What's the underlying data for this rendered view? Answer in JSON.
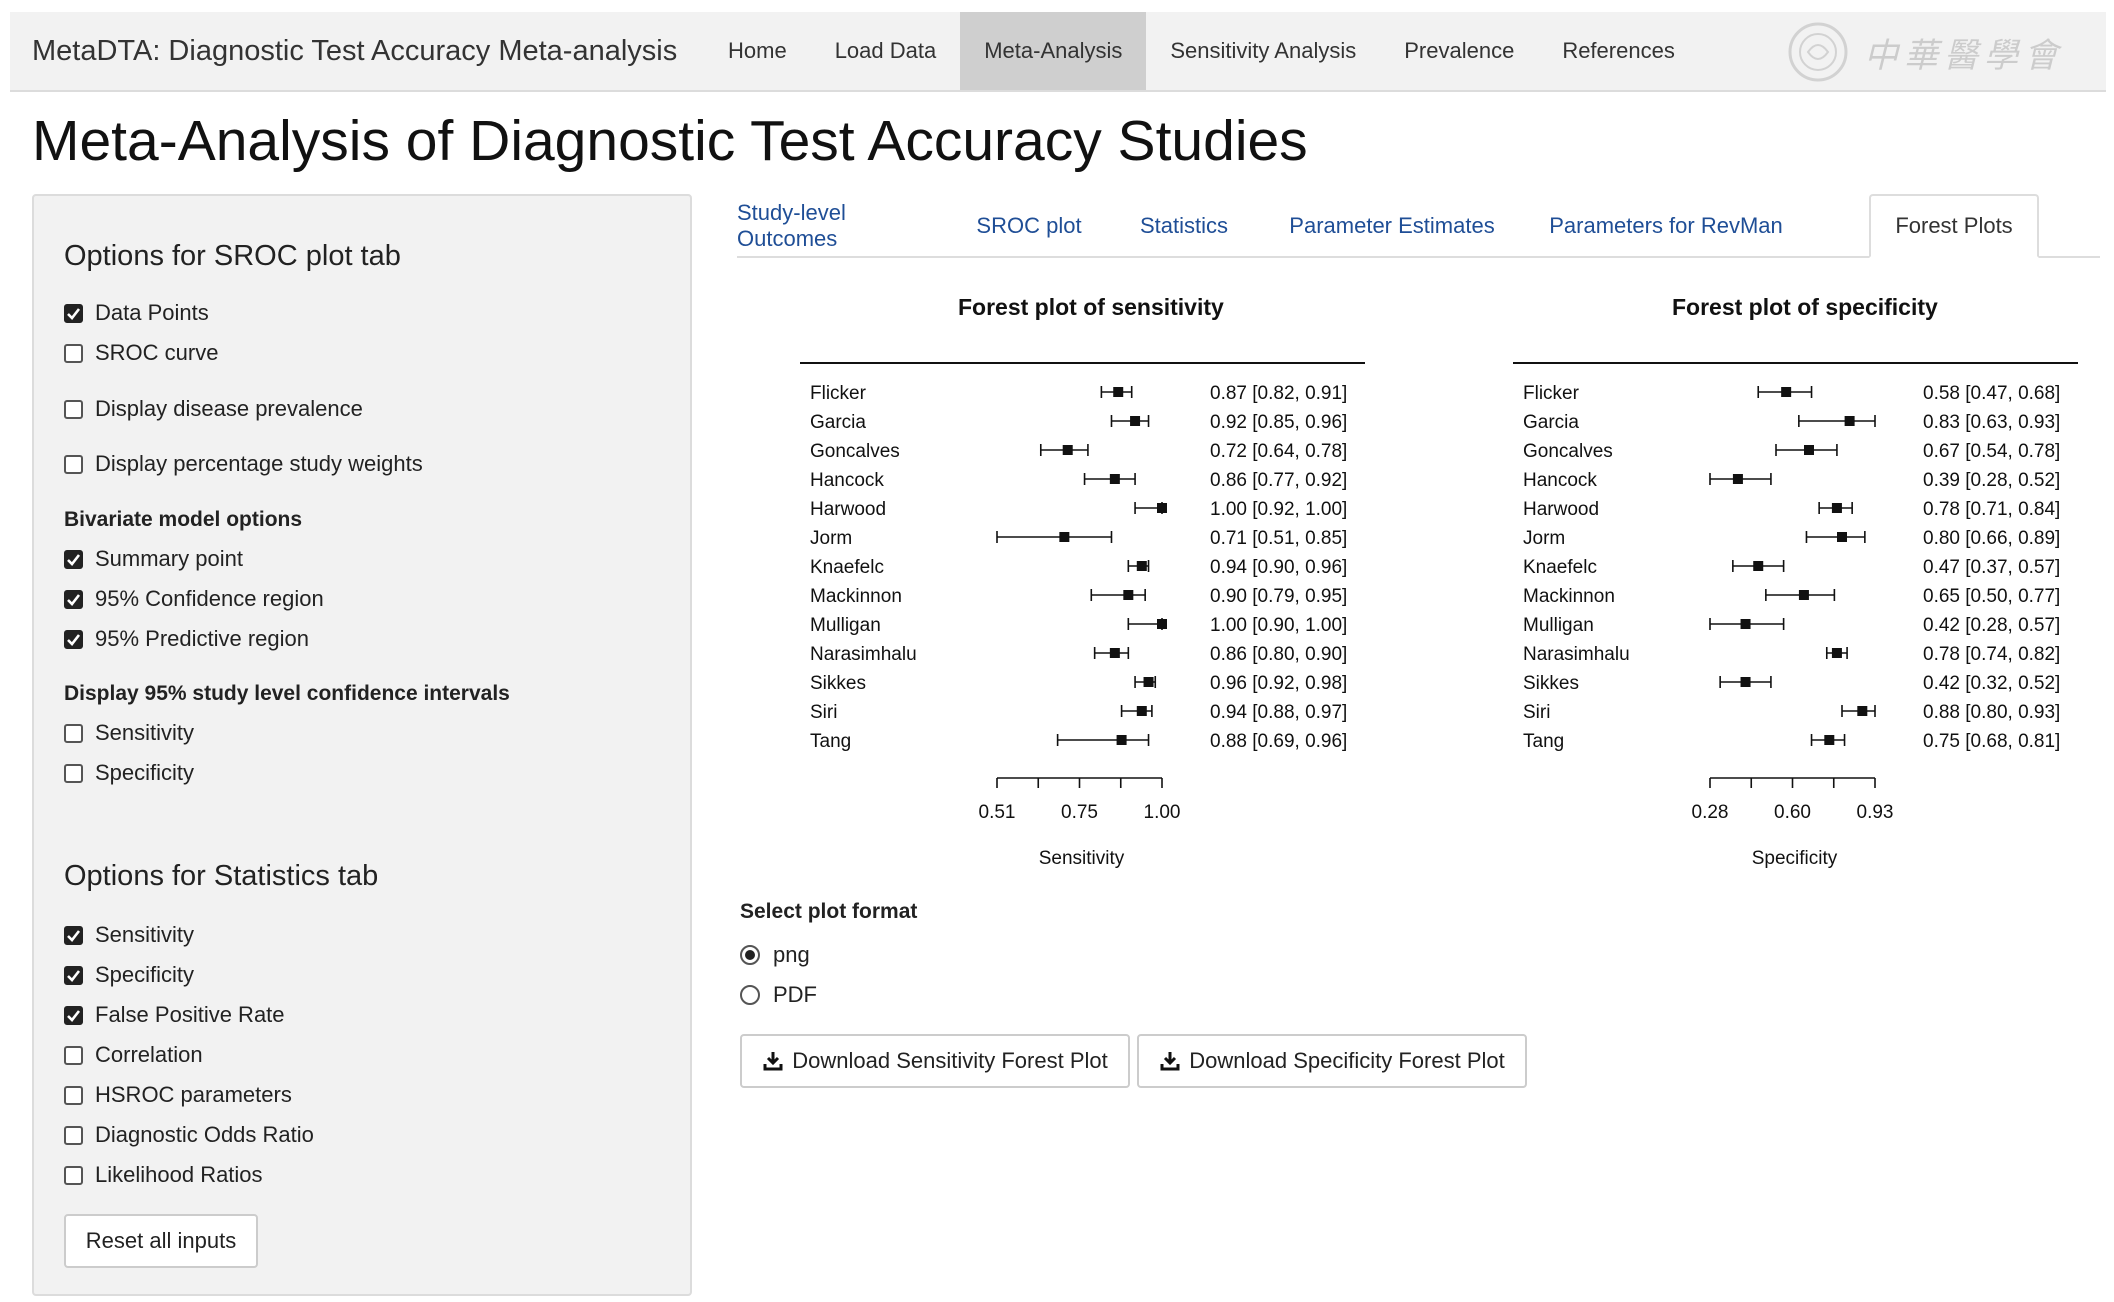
{
  "navbar": {
    "brand": "MetaDTA: Diagnostic Test Accuracy Meta-analysis",
    "items": [
      "Home",
      "Load Data",
      "Meta-Analysis",
      "Sensitivity Analysis",
      "Prevalence",
      "References"
    ],
    "active": "Meta-Analysis"
  },
  "page_title": "Meta-Analysis of Diagnostic Test Accuracy Studies",
  "sidebar": {
    "sroc_heading": "Options for SROC plot tab",
    "sroc_options": [
      {
        "label": "Data Points",
        "checked": true
      },
      {
        "label": "SROC curve",
        "checked": false
      },
      {
        "label": "Display disease prevalence",
        "checked": false
      },
      {
        "label": "Display percentage study weights",
        "checked": false
      }
    ],
    "bivariate_heading": "Bivariate model options",
    "bivariate_options": [
      {
        "label": "Summary point",
        "checked": true
      },
      {
        "label": "95% Confidence region",
        "checked": true
      },
      {
        "label": "95% Predictive region",
        "checked": true
      }
    ],
    "ci_heading": "Display 95% study level confidence intervals",
    "ci_options": [
      {
        "label": "Sensitivity",
        "checked": false
      },
      {
        "label": "Specificity",
        "checked": false
      }
    ],
    "stats_heading": "Options for Statistics tab",
    "stats_options": [
      {
        "label": "Sensitivity",
        "checked": true
      },
      {
        "label": "Specificity",
        "checked": true
      },
      {
        "label": "False Positive Rate",
        "checked": true
      },
      {
        "label": "Correlation",
        "checked": false
      },
      {
        "label": "HSROC parameters",
        "checked": false
      },
      {
        "label": "Diagnostic Odds Ratio",
        "checked": false
      },
      {
        "label": "Likelihood Ratios",
        "checked": false
      }
    ],
    "reset_label": "Reset all inputs"
  },
  "tabs": {
    "items": [
      "Study-level Outcomes",
      "SROC plot",
      "Statistics",
      "Parameter Estimates",
      "Parameters for RevMan",
      "Forest Plots"
    ],
    "active": "Forest Plots"
  },
  "chart_data": [
    {
      "type": "forest",
      "title": "Forest plot of sensitivity",
      "xlabel": "Sensitivity",
      "xticks": [
        "0.51",
        "0.75",
        "1.00"
      ],
      "xlim": [
        0.51,
        1.0
      ],
      "studies": [
        "Flicker",
        "Garcia",
        "Goncalves",
        "Hancock",
        "Harwood",
        "Jorm",
        "Knaefelc",
        "Mackinnon",
        "Mulligan",
        "Narasimhalu",
        "Sikkes",
        "Siri",
        "Tang"
      ],
      "estimates": [
        0.87,
        0.92,
        0.72,
        0.86,
        1.0,
        0.71,
        0.94,
        0.9,
        1.0,
        0.86,
        0.96,
        0.94,
        0.88
      ],
      "lower": [
        0.82,
        0.85,
        0.64,
        0.77,
        0.92,
        0.51,
        0.9,
        0.79,
        0.9,
        0.8,
        0.92,
        0.88,
        0.69
      ],
      "upper": [
        0.91,
        0.96,
        0.78,
        0.92,
        1.0,
        0.85,
        0.96,
        0.95,
        1.0,
        0.9,
        0.98,
        0.97,
        0.96
      ],
      "labels": [
        "0.87 [0.82, 0.91]",
        "0.92 [0.85, 0.96]",
        "0.72 [0.64, 0.78]",
        "0.86 [0.77, 0.92]",
        "1.00 [0.92, 1.00]",
        "0.71 [0.51, 0.85]",
        "0.94 [0.90, 0.96]",
        "0.90 [0.79, 0.95]",
        "1.00 [0.90, 1.00]",
        "0.86 [0.80, 0.90]",
        "0.96 [0.92, 0.98]",
        "0.94 [0.88, 0.97]",
        "0.88 [0.69, 0.96]"
      ]
    },
    {
      "type": "forest",
      "title": "Forest plot of specificity",
      "xlabel": "Specificity",
      "xticks": [
        "0.28",
        "0.60",
        "0.93"
      ],
      "xlim": [
        0.28,
        0.93
      ],
      "studies": [
        "Flicker",
        "Garcia",
        "Goncalves",
        "Hancock",
        "Harwood",
        "Jorm",
        "Knaefelc",
        "Mackinnon",
        "Mulligan",
        "Narasimhalu",
        "Sikkes",
        "Siri",
        "Tang"
      ],
      "estimates": [
        0.58,
        0.83,
        0.67,
        0.39,
        0.78,
        0.8,
        0.47,
        0.65,
        0.42,
        0.78,
        0.42,
        0.88,
        0.75
      ],
      "lower": [
        0.47,
        0.63,
        0.54,
        0.28,
        0.71,
        0.66,
        0.37,
        0.5,
        0.28,
        0.74,
        0.32,
        0.8,
        0.68
      ],
      "upper": [
        0.68,
        0.93,
        0.78,
        0.52,
        0.84,
        0.89,
        0.57,
        0.77,
        0.57,
        0.82,
        0.52,
        0.93,
        0.81
      ],
      "labels": [
        "0.58 [0.47, 0.68]",
        "0.83 [0.63, 0.93]",
        "0.67 [0.54, 0.78]",
        "0.39 [0.28, 0.52]",
        "0.78 [0.71, 0.84]",
        "0.80 [0.66, 0.89]",
        "0.47 [0.37, 0.57]",
        "0.65 [0.50, 0.77]",
        "0.42 [0.28, 0.57]",
        "0.78 [0.74, 0.82]",
        "0.42 [0.32, 0.52]",
        "0.88 [0.80, 0.93]",
        "0.75 [0.68, 0.81]"
      ]
    }
  ],
  "format": {
    "label": "Select plot format",
    "options": [
      "png",
      "PDF"
    ],
    "selected": "png"
  },
  "downloads": {
    "sensitivity": "Download Sensitivity Forest Plot",
    "specificity": "Download Specificity Forest Plot"
  },
  "icons": {
    "download": "download-icon",
    "checkmark": "check-icon",
    "watermark": "journal-seal-icon"
  }
}
